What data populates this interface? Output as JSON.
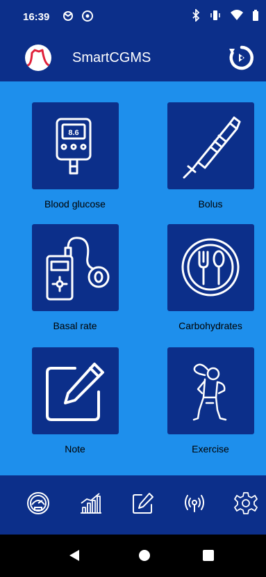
{
  "status_bar": {
    "time": "16:39",
    "icons": [
      "notification-icon",
      "sync-icon",
      "bluetooth-icon",
      "vibrate-icon",
      "wifi-icon",
      "battery-icon"
    ]
  },
  "app_bar": {
    "title": "SmartCGMS",
    "logo_icon": "glucose-curve-logo",
    "action_icon": "refresh-icon"
  },
  "tiles": [
    {
      "id": "blood-glucose",
      "label": "Blood glucose",
      "icon": "glucometer-icon",
      "display_value": "8.6"
    },
    {
      "id": "bolus",
      "label": "Bolus",
      "icon": "insulin-pen-icon"
    },
    {
      "id": "basal-rate",
      "label": "Basal rate",
      "icon": "insulin-pump-icon"
    },
    {
      "id": "carbohydrates",
      "label": "Carbohydrates",
      "icon": "plate-fork-spoon-icon"
    },
    {
      "id": "note",
      "label": "Note",
      "icon": "edit-note-icon"
    },
    {
      "id": "exercise",
      "label": "Exercise",
      "icon": "stretching-person-icon"
    }
  ],
  "bottom_tabs": [
    {
      "id": "dashboard",
      "icon": "gauge-icon"
    },
    {
      "id": "charts",
      "icon": "chart-icon"
    },
    {
      "id": "notes",
      "icon": "edit-icon"
    },
    {
      "id": "connectivity",
      "icon": "signal-icon"
    },
    {
      "id": "settings",
      "icon": "gear-icon"
    }
  ],
  "colors": {
    "primary_dark": "#0c2f8a",
    "content_background": "#1e8fec",
    "icon_white": "#ffffff",
    "logo_curve": "#e0203a"
  }
}
